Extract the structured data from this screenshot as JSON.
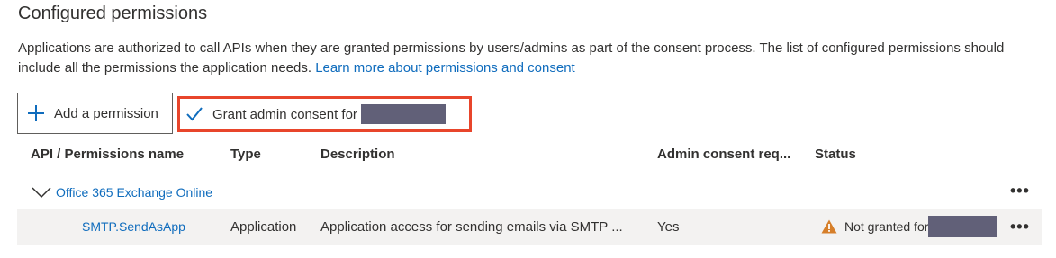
{
  "section": {
    "title": "Configured permissions",
    "description": "Applications are authorized to call APIs when they are granted permissions by users/admins as part of the consent process. The list of configured permissions should include all the permissions the application needs.",
    "learn_more_link": "Learn more about permissions and consent"
  },
  "toolbar": {
    "add_permission_label": "Add a permission",
    "grant_consent_label": "Grant admin consent for"
  },
  "table": {
    "headers": {
      "api": "API / Permissions name",
      "type": "Type",
      "description": "Description",
      "admin_consent": "Admin consent req...",
      "status": "Status"
    },
    "groups": [
      {
        "name": "Office 365 Exchange Online",
        "permissions": [
          {
            "name": "SMTP.SendAsApp",
            "type": "Application",
            "description": "Application access for sending emails via SMTP ...",
            "admin_consent": "Yes",
            "status": "Not granted for"
          }
        ]
      }
    ]
  },
  "colors": {
    "accent": "#0f6cbd",
    "highlight_border": "#e8452b",
    "warning": "#d67f2a",
    "redaction": "#616078",
    "row_selected": "#f3f2f1"
  }
}
